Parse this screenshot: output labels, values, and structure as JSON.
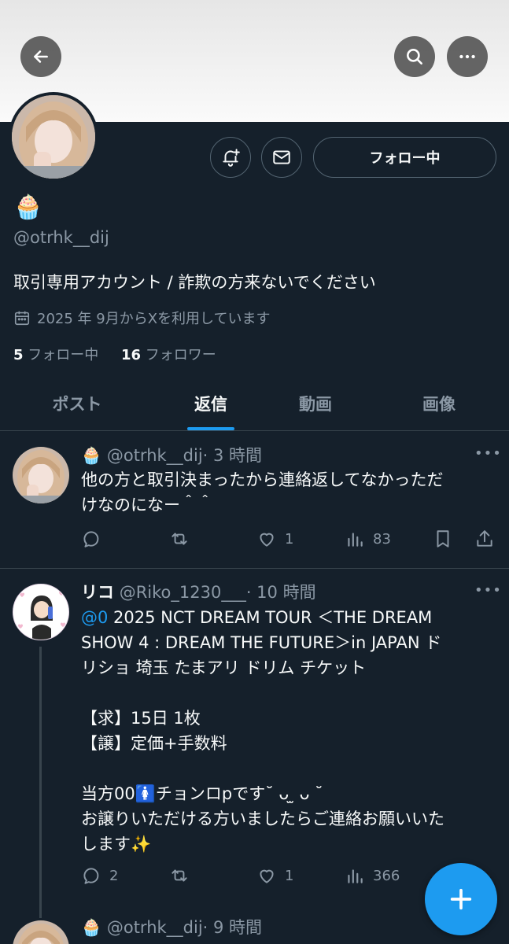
{
  "profile": {
    "display_emoji": "🧁",
    "handle": "@otrhk__dij",
    "bio": "取引専用アカウント / 詐欺の方来ないでください",
    "joined": "2025 年 9月からXを利用しています",
    "following_count": "5",
    "following_label": "フォロー中",
    "followers_count": "16",
    "followers_label": "フォロワー",
    "follow_button_label": "フォロー中"
  },
  "tabs": [
    {
      "label": "ポスト"
    },
    {
      "label": "返信"
    },
    {
      "label": "動画"
    },
    {
      "label": "画像"
    }
  ],
  "posts": [
    {
      "name_emoji": "🧁",
      "handle": "@otrhk__dij",
      "time": "· 3 時間",
      "text_line1": "他の方と取引決まったから連絡返してなかっただ",
      "text_line2": "けなのになー＾＾",
      "replies": "",
      "retweets": "",
      "likes": "1",
      "views": "83"
    },
    {
      "name": "リコ",
      "handle": "@Riko_1230___",
      "time": "· 10 時間",
      "mention": "@0",
      "line1_rest": " 2025 NCT DREAM TOUR ＜THE DREAM",
      "line2": "SHOW 4 : DREAM THE FUTURE＞in JAPAN ド",
      "line3": "リショ 埼玉 たまアリ ドリム チケット",
      "line5": "【求】15日 1枚",
      "line6": "【譲】定価+手数料",
      "line8": "当方00🚺チョンロpです˘ ᴗ ̫ ᴗ ˘",
      "line9": "お譲りいただける方いましたらご連絡お願いいた",
      "line10": "します✨",
      "replies": "2",
      "likes": "1",
      "views": "366"
    },
    {
      "name_emoji": "🧁",
      "handle": "@otrhk__dij",
      "time": "· 9 時間"
    }
  ],
  "colors": {
    "background": "#15202b",
    "accent": "#1d9bf0",
    "muted_text": "#8b98a5",
    "border": "#38444d"
  },
  "icons": [
    "back-arrow-icon",
    "search-icon",
    "more-icon",
    "notify-bell-icon",
    "mail-icon",
    "calendar-icon",
    "reply-icon",
    "retweet-icon",
    "like-icon",
    "views-icon",
    "bookmark-icon",
    "share-icon",
    "compose-plus-icon"
  ]
}
